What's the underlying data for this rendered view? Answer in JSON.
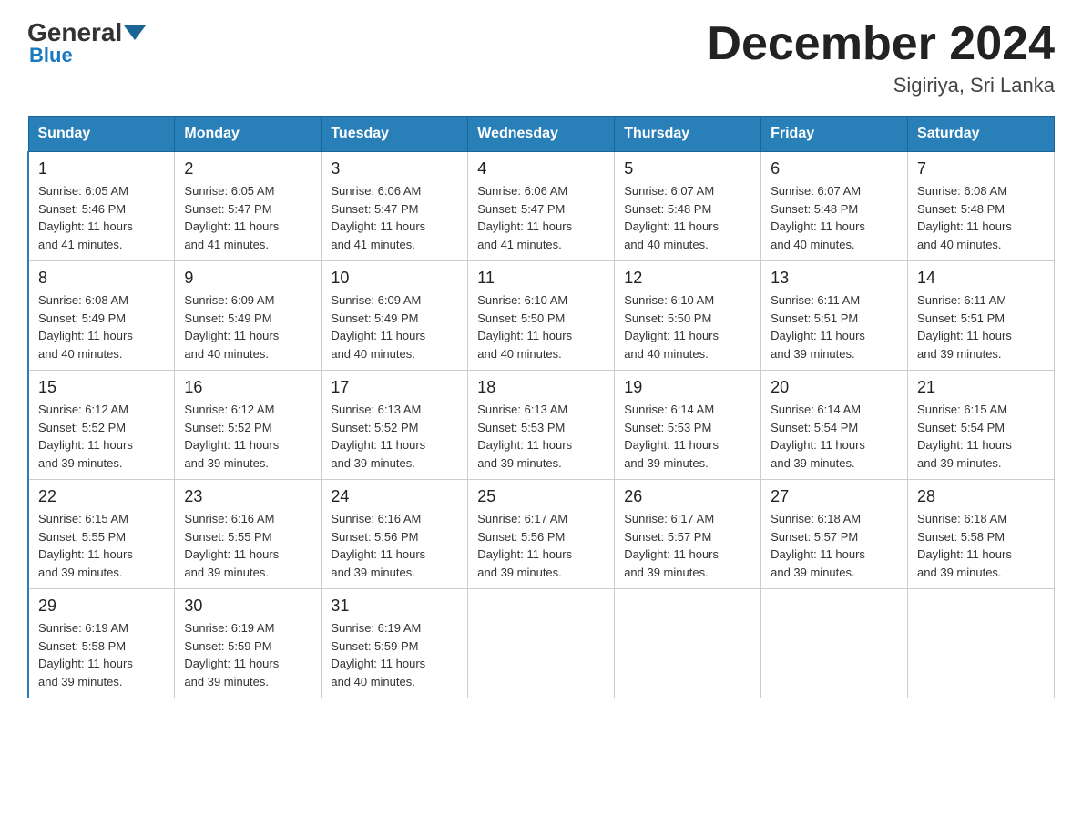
{
  "header": {
    "logo_general": "General",
    "logo_blue": "Blue",
    "title": "December 2024",
    "subtitle": "Sigiriya, Sri Lanka"
  },
  "days_of_week": [
    "Sunday",
    "Monday",
    "Tuesday",
    "Wednesday",
    "Thursday",
    "Friday",
    "Saturday"
  ],
  "weeks": [
    [
      {
        "day": "1",
        "sunrise": "6:05 AM",
        "sunset": "5:46 PM",
        "daylight": "11 hours and 41 minutes."
      },
      {
        "day": "2",
        "sunrise": "6:05 AM",
        "sunset": "5:47 PM",
        "daylight": "11 hours and 41 minutes."
      },
      {
        "day": "3",
        "sunrise": "6:06 AM",
        "sunset": "5:47 PM",
        "daylight": "11 hours and 41 minutes."
      },
      {
        "day": "4",
        "sunrise": "6:06 AM",
        "sunset": "5:47 PM",
        "daylight": "11 hours and 41 minutes."
      },
      {
        "day": "5",
        "sunrise": "6:07 AM",
        "sunset": "5:48 PM",
        "daylight": "11 hours and 40 minutes."
      },
      {
        "day": "6",
        "sunrise": "6:07 AM",
        "sunset": "5:48 PM",
        "daylight": "11 hours and 40 minutes."
      },
      {
        "day": "7",
        "sunrise": "6:08 AM",
        "sunset": "5:48 PM",
        "daylight": "11 hours and 40 minutes."
      }
    ],
    [
      {
        "day": "8",
        "sunrise": "6:08 AM",
        "sunset": "5:49 PM",
        "daylight": "11 hours and 40 minutes."
      },
      {
        "day": "9",
        "sunrise": "6:09 AM",
        "sunset": "5:49 PM",
        "daylight": "11 hours and 40 minutes."
      },
      {
        "day": "10",
        "sunrise": "6:09 AM",
        "sunset": "5:49 PM",
        "daylight": "11 hours and 40 minutes."
      },
      {
        "day": "11",
        "sunrise": "6:10 AM",
        "sunset": "5:50 PM",
        "daylight": "11 hours and 40 minutes."
      },
      {
        "day": "12",
        "sunrise": "6:10 AM",
        "sunset": "5:50 PM",
        "daylight": "11 hours and 40 minutes."
      },
      {
        "day": "13",
        "sunrise": "6:11 AM",
        "sunset": "5:51 PM",
        "daylight": "11 hours and 39 minutes."
      },
      {
        "day": "14",
        "sunrise": "6:11 AM",
        "sunset": "5:51 PM",
        "daylight": "11 hours and 39 minutes."
      }
    ],
    [
      {
        "day": "15",
        "sunrise": "6:12 AM",
        "sunset": "5:52 PM",
        "daylight": "11 hours and 39 minutes."
      },
      {
        "day": "16",
        "sunrise": "6:12 AM",
        "sunset": "5:52 PM",
        "daylight": "11 hours and 39 minutes."
      },
      {
        "day": "17",
        "sunrise": "6:13 AM",
        "sunset": "5:52 PM",
        "daylight": "11 hours and 39 minutes."
      },
      {
        "day": "18",
        "sunrise": "6:13 AM",
        "sunset": "5:53 PM",
        "daylight": "11 hours and 39 minutes."
      },
      {
        "day": "19",
        "sunrise": "6:14 AM",
        "sunset": "5:53 PM",
        "daylight": "11 hours and 39 minutes."
      },
      {
        "day": "20",
        "sunrise": "6:14 AM",
        "sunset": "5:54 PM",
        "daylight": "11 hours and 39 minutes."
      },
      {
        "day": "21",
        "sunrise": "6:15 AM",
        "sunset": "5:54 PM",
        "daylight": "11 hours and 39 minutes."
      }
    ],
    [
      {
        "day": "22",
        "sunrise": "6:15 AM",
        "sunset": "5:55 PM",
        "daylight": "11 hours and 39 minutes."
      },
      {
        "day": "23",
        "sunrise": "6:16 AM",
        "sunset": "5:55 PM",
        "daylight": "11 hours and 39 minutes."
      },
      {
        "day": "24",
        "sunrise": "6:16 AM",
        "sunset": "5:56 PM",
        "daylight": "11 hours and 39 minutes."
      },
      {
        "day": "25",
        "sunrise": "6:17 AM",
        "sunset": "5:56 PM",
        "daylight": "11 hours and 39 minutes."
      },
      {
        "day": "26",
        "sunrise": "6:17 AM",
        "sunset": "5:57 PM",
        "daylight": "11 hours and 39 minutes."
      },
      {
        "day": "27",
        "sunrise": "6:18 AM",
        "sunset": "5:57 PM",
        "daylight": "11 hours and 39 minutes."
      },
      {
        "day": "28",
        "sunrise": "6:18 AM",
        "sunset": "5:58 PM",
        "daylight": "11 hours and 39 minutes."
      }
    ],
    [
      {
        "day": "29",
        "sunrise": "6:19 AM",
        "sunset": "5:58 PM",
        "daylight": "11 hours and 39 minutes."
      },
      {
        "day": "30",
        "sunrise": "6:19 AM",
        "sunset": "5:59 PM",
        "daylight": "11 hours and 39 minutes."
      },
      {
        "day": "31",
        "sunrise": "6:19 AM",
        "sunset": "5:59 PM",
        "daylight": "11 hours and 40 minutes."
      },
      null,
      null,
      null,
      null
    ]
  ],
  "labels": {
    "sunrise": "Sunrise:",
    "sunset": "Sunset:",
    "daylight": "Daylight:"
  }
}
